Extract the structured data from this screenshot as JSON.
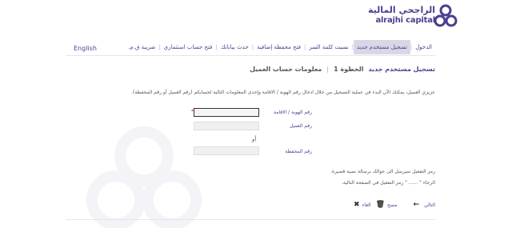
{
  "brand": {
    "name_ar": "الراجحي المالية",
    "name_en": "alrajhi capital",
    "color": "#4a3f8f"
  },
  "nav": {
    "items": [
      {
        "label": "الدخول",
        "active": false
      },
      {
        "label": "تسجيل مستخدم جديد",
        "active": true
      },
      {
        "label": "نسيت كلمة السر",
        "active": false
      },
      {
        "label": "فتح محفظة إضافية",
        "active": false
      },
      {
        "label": "حدث بياناتك",
        "active": false
      },
      {
        "label": "فتح حساب استثماري",
        "active": false
      },
      {
        "label": "ضريبة ق.م.",
        "active": false
      }
    ],
    "language": "English"
  },
  "breadcrumb": {
    "title": "تسجيل مستخدم جديد",
    "step": "الخطوة 1",
    "section": "معلومات حساب العميل"
  },
  "intro": "عزيزي العميل، يمكنك الآن البدء في عملية التسجيل من خلال ادخال رقم الهوية / الاقامة وإحدى المعلومات التالية لحسابكم (رقم العميل أو رقم المحفظة).",
  "form": {
    "id_label": "رقم الهوية / الاقامة",
    "id_value": "",
    "customer_label": "رقم العميل",
    "customer_value": "",
    "or_text": "أو",
    "portfolio_label": "رقم المحفظة",
    "portfolio_value": ""
  },
  "notes": {
    "line1": "رمز التفعيل سيرسل الى جوالك برسالة نصية قصيرة.",
    "line2": "الرجاء \" ...... \" رمز التفعيل في الصفحة التالية."
  },
  "actions": {
    "next": "التالي",
    "clear": "مسح",
    "cancel": "الغاء"
  },
  "icons": {
    "next": "arrow-left-icon",
    "clear": "trash-icon",
    "cancel": "close-icon"
  }
}
